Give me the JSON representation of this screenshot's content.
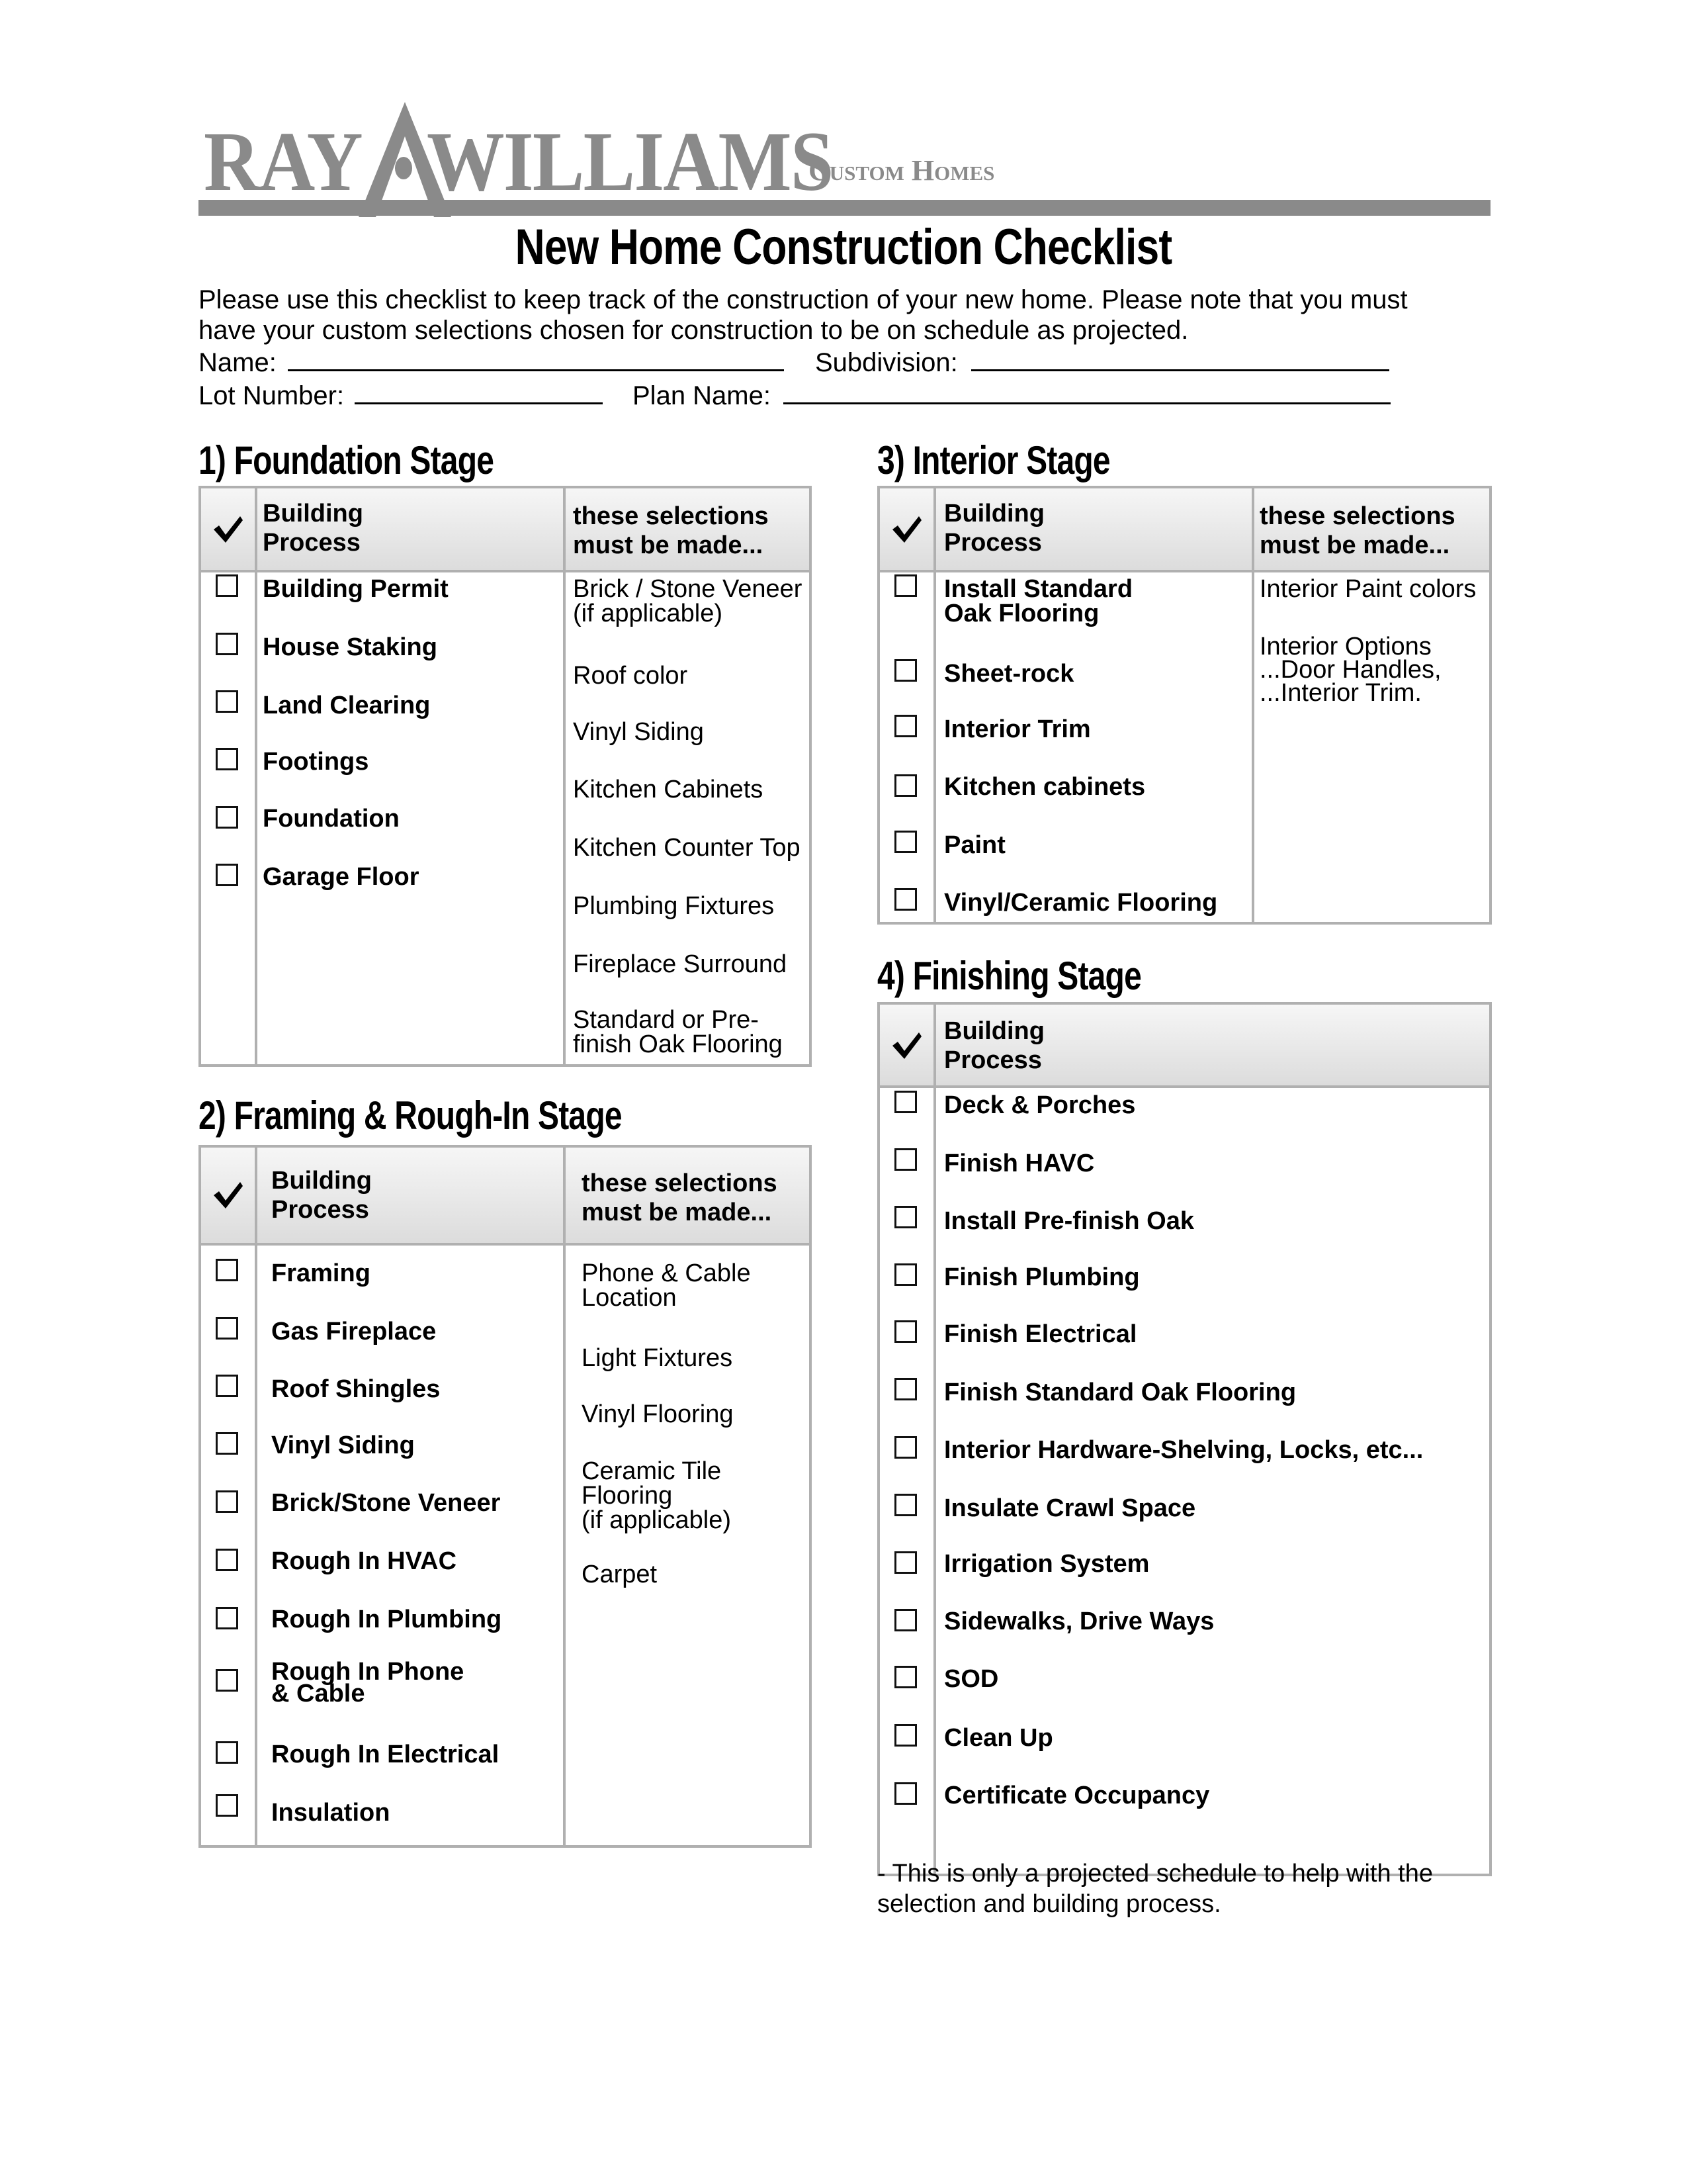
{
  "logo": {
    "word1": "RAY",
    "word2": "WILLIAMS",
    "subtitle": "Custom Homes",
    "brand_color": "#8a8a8a"
  },
  "title": "New Home Construction Checklist",
  "intro": {
    "line1": "Please use this checklist to keep track of the construction of your new home. Please note that you must",
    "line2": "have your custom selections chosen for construction to be on schedule as projected."
  },
  "fields": {
    "name_label": "Name:",
    "name_value": "",
    "subdivision_label": "Subdivision:",
    "subdivision_value": "",
    "lot_label": "Lot Number:",
    "lot_value": "",
    "plan_label": "Plan Name:",
    "plan_value": ""
  },
  "table_headers": {
    "process": "Building\nProcess",
    "process_line1": "Building",
    "process_line2": "Process",
    "selections_line1": "these selections",
    "selections_line2": "must be made..."
  },
  "sections": [
    {
      "heading": "1) Foundation Stage",
      "items": [
        "Building Permit",
        "House Staking",
        "Land Clearing",
        "Footings",
        "Foundation",
        "Garage Floor"
      ],
      "selections": [
        "Brick / Stone Veneer\n(if applicable)",
        "Roof color",
        "Vinyl Siding",
        "Kitchen Cabinets",
        "Kitchen Counter Top",
        "Plumbing Fixtures",
        "Fireplace Surround",
        "Standard or Pre-\nfinish Oak Flooring"
      ]
    },
    {
      "heading": "2) Framing & Rough-In Stage",
      "items": [
        "Framing",
        "Gas Fireplace",
        "Roof Shingles",
        "Vinyl Siding",
        "Brick/Stone Veneer",
        "Rough In HVAC",
        "Rough In Plumbing",
        "Rough In Phone\n& Cable",
        "Rough In Electrical",
        "Insulation"
      ],
      "selections": [
        "Phone & Cable\nLocation",
        "Light Fixtures",
        "Vinyl Flooring",
        "Ceramic Tile\nFlooring\n(if applicable)",
        "Carpet"
      ]
    },
    {
      "heading": "3) Interior Stage",
      "items": [
        "Install Standard\nOak Flooring",
        "Sheet-rock",
        "Interior Trim",
        "Kitchen cabinets",
        "Paint",
        "Vinyl/Ceramic Flooring"
      ],
      "selections": [
        "Interior Paint colors",
        "Interior Options\n...Door Handles,\n...Interior Trim."
      ]
    },
    {
      "heading": "4) Finishing Stage",
      "items": [
        "Deck & Porches",
        "Finish HAVC",
        "Install Pre-finish Oak",
        "Finish Plumbing",
        "Finish Electrical",
        "Finish Standard Oak Flooring",
        "Interior Hardware-Shelving, Locks, etc...",
        "Insulate Crawl Space",
        "Irrigation System",
        "Sidewalks, Drive Ways",
        "SOD",
        "Clean Up",
        "Certificate Occupancy"
      ],
      "selections": []
    }
  ],
  "checkbox_states": {
    "foundation": [
      false,
      false,
      false,
      false,
      false,
      false
    ],
    "framing": [
      false,
      false,
      false,
      false,
      false,
      false,
      false,
      false,
      false,
      false
    ],
    "interior": [
      false,
      false,
      false,
      false,
      false,
      false
    ],
    "finishing": [
      false,
      false,
      false,
      false,
      false,
      false,
      false,
      false,
      false,
      false,
      false,
      false,
      false
    ]
  },
  "footnote": {
    "line1": "- This is only a projected schedule to help with the",
    "line2": "selection and building process."
  },
  "icons": {
    "header_check": "checkmark-icon",
    "row_box": "checkbox-icon",
    "logo_roof": "roof-peak-icon"
  }
}
